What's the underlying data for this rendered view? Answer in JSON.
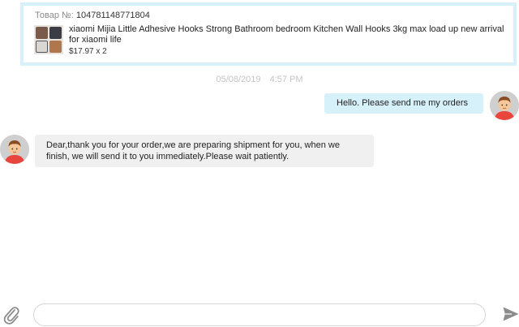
{
  "order_card": {
    "number_label": "Товар №:",
    "number_value": "104781148771804",
    "product_title": "xiaomi Mijia Little Adhesive Hooks Strong Bathroom bedroom Kitchen Wall Hooks 3kg max load up new arrival for xiaomi life",
    "price": "$17.97 x 2",
    "thumb_icon": "product-thumbnail"
  },
  "timestamp": {
    "date": "05/08/2019",
    "time": "4:57 PM"
  },
  "messages": [
    {
      "direction": "outgoing",
      "text": "Hello. Please send me my orders",
      "avatar_icon": "user-avatar"
    },
    {
      "direction": "incoming",
      "text": "Dear,thank you for your order,we are preparing shipment for you, when we finish, we will send it to you immediately.Please wait patiently.",
      "avatar_icon": "seller-avatar"
    }
  ],
  "composer": {
    "placeholder": "",
    "value": "",
    "attach_icon": "paperclip-icon",
    "send_icon": "send-icon"
  },
  "colors": {
    "accent_bubble": "#d7f1fb",
    "incoming_bubble": "#f0f0f0",
    "timestamp": "#c5c5c5",
    "icon": "#8c8c8c"
  }
}
